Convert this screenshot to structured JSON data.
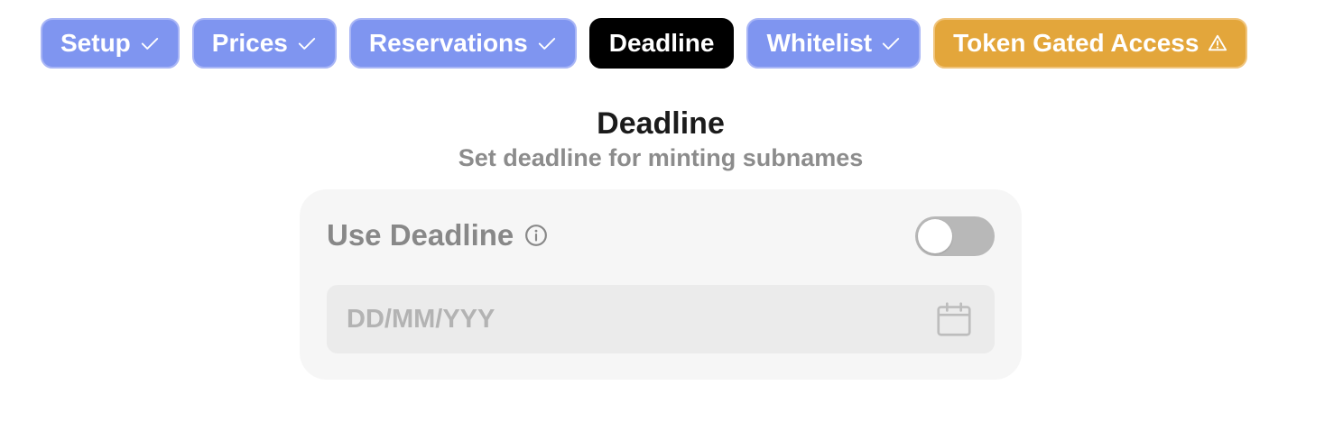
{
  "steps": [
    {
      "label": "Setup",
      "status": "done",
      "icon": "check-icon"
    },
    {
      "label": "Prices",
      "status": "done",
      "icon": "check-icon"
    },
    {
      "label": "Reservations",
      "status": "done",
      "icon": "check-icon"
    },
    {
      "label": "Deadline",
      "status": "active",
      "icon": ""
    },
    {
      "label": "Whitelist",
      "status": "done",
      "icon": "check-icon"
    },
    {
      "label": "Token Gated Access",
      "status": "warning",
      "icon": "warning-icon"
    }
  ],
  "section": {
    "title": "Deadline",
    "subtitle": "Set deadline for minting subnames"
  },
  "use_deadline": {
    "label": "Use Deadline",
    "info_icon": "info-icon",
    "enabled": false
  },
  "date_field": {
    "value": "",
    "placeholder": "DD/MM/YYY",
    "icon": "calendar-icon"
  },
  "colors": {
    "step_done": "#7f95f0",
    "step_active": "#000000",
    "step_warning": "#e3a63b",
    "card_bg": "#f6f6f6",
    "toggle_off": "#b8b8b8"
  }
}
